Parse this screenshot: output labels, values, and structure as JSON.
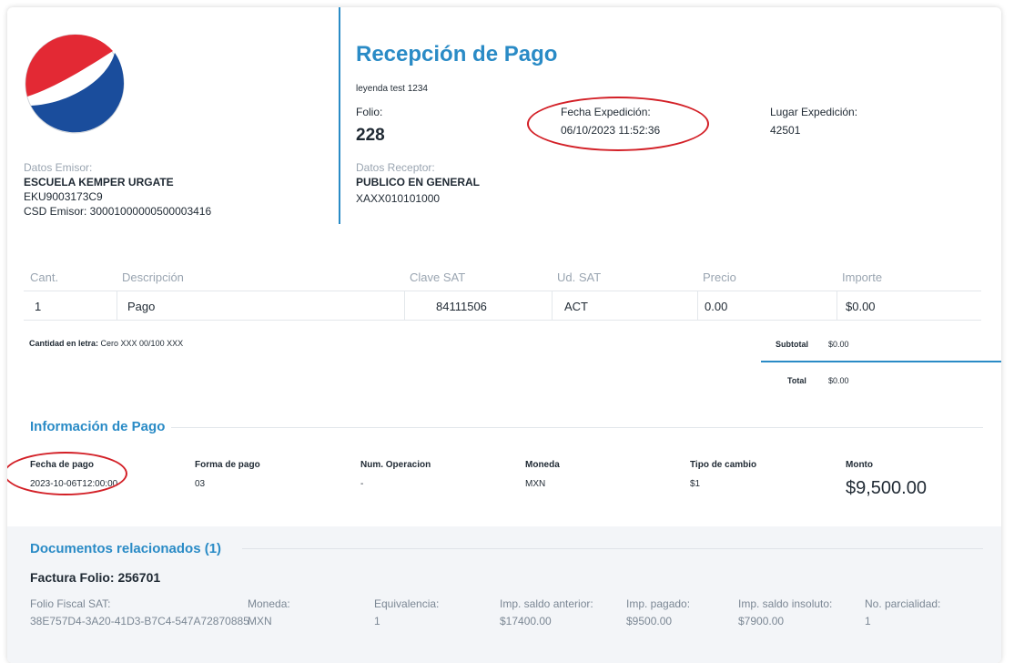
{
  "header": {
    "title": "Recepción de Pago",
    "leyenda": "leyenda test 1234",
    "folio_label": "Folio:",
    "folio_value": "228",
    "fecha_exp_label": "Fecha Expedición:",
    "fecha_exp_value": "06/10/2023 11:52:36",
    "lugar_exp_label": "Lugar Expedición:",
    "lugar_exp_value": "42501"
  },
  "emisor": {
    "label": "Datos Emisor:",
    "name": "ESCUELA KEMPER URGATE",
    "rfc": "EKU9003173C9",
    "csd": "CSD Emisor: 30001000000500003416"
  },
  "receptor": {
    "label": "Datos Receptor:",
    "name": "PUBLICO EN GENERAL",
    "rfc": "XAXX010101000"
  },
  "items_table": {
    "headers": [
      "Cant.",
      "Descripción",
      "Clave SAT",
      "Ud. SAT",
      "Precio",
      "Importe"
    ],
    "rows": [
      [
        "1",
        "Pago",
        "84111506",
        "ACT",
        "0.00",
        "$0.00"
      ]
    ]
  },
  "totals": {
    "cantidad_letra_label": "Cantidad en letra:",
    "cantidad_letra_value": "Cero XXX 00/100 XXX",
    "subtotal_label": "Subtotal",
    "subtotal_value": "$0.00",
    "total_label": "Total",
    "total_value": "$0.00"
  },
  "pago": {
    "title": "Información de Pago",
    "fecha_label": "Fecha de pago",
    "fecha_value": "2023-10-06T12:00:00",
    "forma_label": "Forma de pago",
    "forma_value": "03",
    "operacion_label": "Num. Operacion",
    "operacion_value": "-",
    "moneda_label": "Moneda",
    "moneda_value": "MXN",
    "cambio_label": "Tipo de cambio",
    "cambio_value": "$1",
    "monto_label": "Monto",
    "monto_value": "$9,500.00"
  },
  "docs": {
    "title": "Documentos relacionados (1)",
    "factura": "Factura Folio: 256701",
    "folio_fiscal_label": "Folio Fiscal SAT:",
    "folio_fiscal_value": "38E757D4-3A20-41D3-B7C4-547A72870885",
    "moneda_label": "Moneda:",
    "moneda_value": "MXN",
    "equivalencia_label": "Equivalencia:",
    "equivalencia_value": "1",
    "saldo_ant_label": "Imp. saldo anterior:",
    "saldo_ant_value": "$17400.00",
    "pagado_label": "Imp. pagado:",
    "pagado_value": "$9500.00",
    "insoluto_label": "Imp. saldo insoluto:",
    "insoluto_value": "$7900.00",
    "parcialidad_label": "No. parcialidad:",
    "parcialidad_value": "1"
  },
  "colors": {
    "accent": "#2a8bc6",
    "annotation": "#d32027",
    "logo_red": "#e32934",
    "logo_blue": "#1a4d9c"
  }
}
